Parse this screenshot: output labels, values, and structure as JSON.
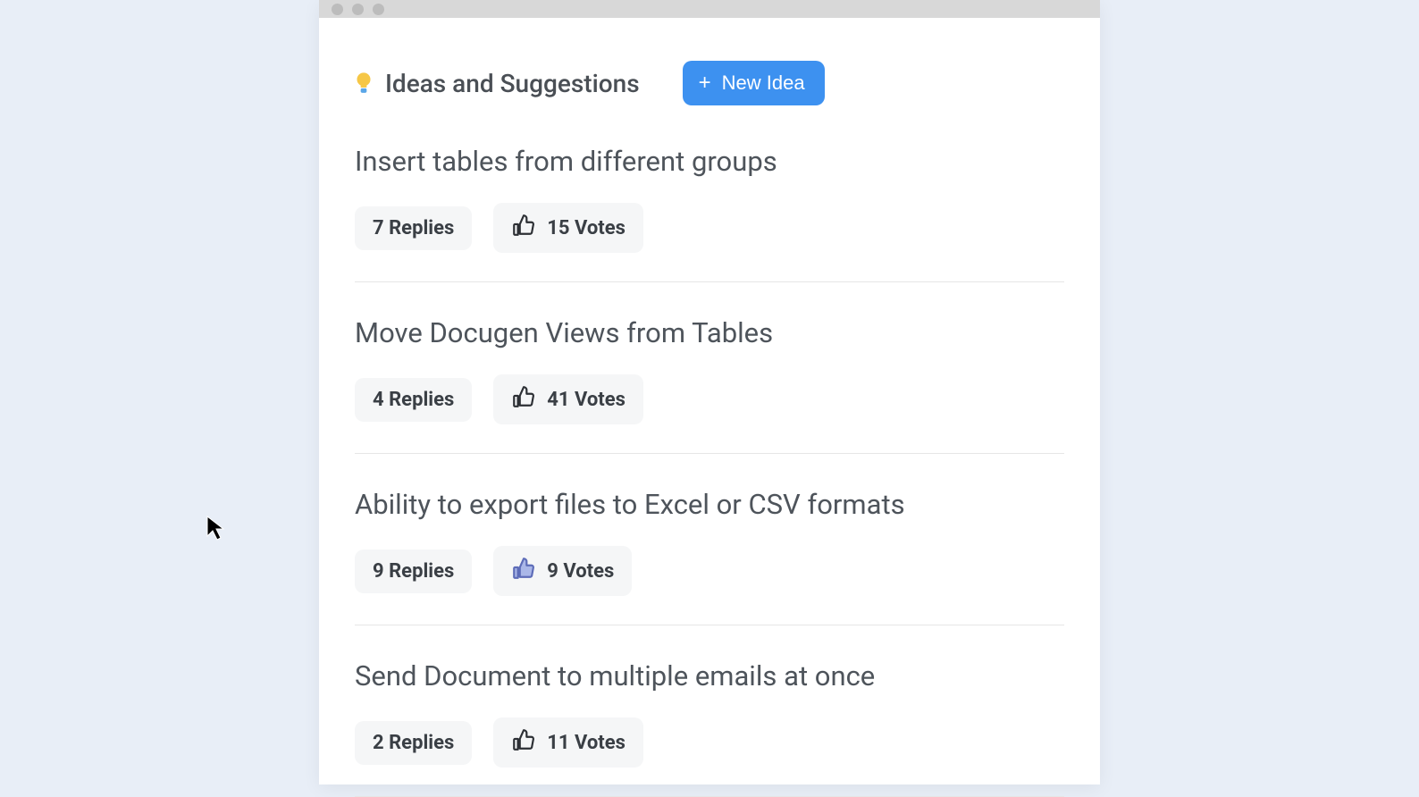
{
  "header": {
    "title": "Ideas and Suggestions",
    "new_idea_label": "New Idea"
  },
  "ideas": [
    {
      "title": "Insert tables from different groups",
      "replies_label": "7 Replies",
      "votes_label": "15 Votes",
      "voted": false
    },
    {
      "title": "Move Docugen Views from Tables",
      "replies_label": "4 Replies",
      "votes_label": "41 Votes",
      "voted": false
    },
    {
      "title": "Ability to export files to Excel or CSV formats",
      "replies_label": "9 Replies",
      "votes_label": "9 Votes",
      "voted": true
    },
    {
      "title": "Send Document to multiple emails at once",
      "replies_label": "2 Replies",
      "votes_label": "11 Votes",
      "voted": false
    }
  ]
}
